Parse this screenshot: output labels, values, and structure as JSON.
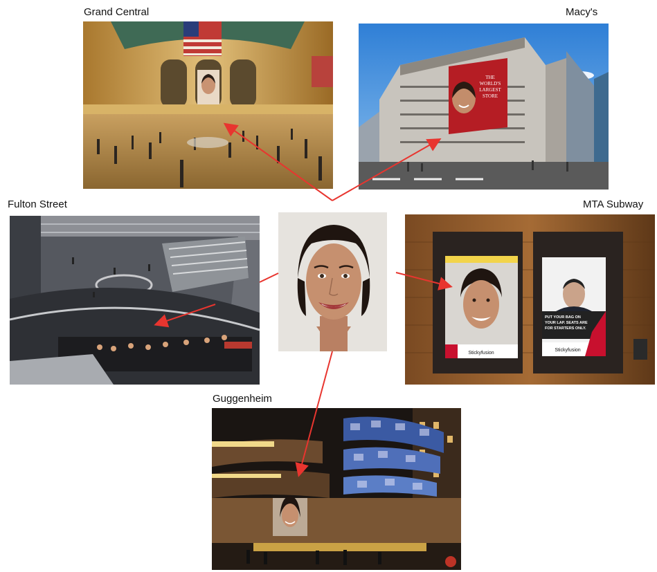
{
  "labels": {
    "grand_central": "Grand Central",
    "macys": "Macy's",
    "fulton_street": "Fulton Street",
    "mta_subway": "MTA Subway",
    "guggenheim": "Guggenheim"
  },
  "poster_text": {
    "macys_banner": "THE WORLD'S LARGEST STORE",
    "mta_left_brand": "Stickyfusion",
    "mta_right_headline": "PUT YOUR BAG ON YOUR LAP. SEATS ARE FOR STARTERS ONLY.",
    "mta_right_brand": "Stickyfusion"
  },
  "colors": {
    "arrow": "#e8352f",
    "label_text": "#111111"
  }
}
